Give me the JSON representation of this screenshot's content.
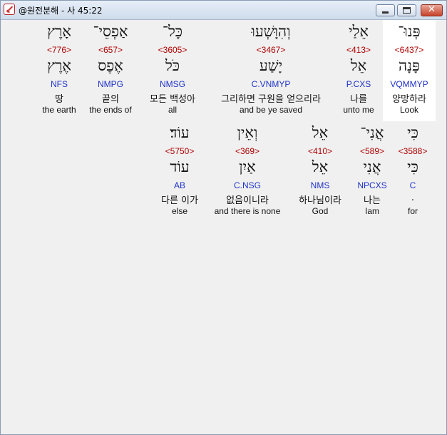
{
  "window": {
    "title": "@원전분해 - 사 45:22"
  },
  "rows": [
    [
      {
        "surface": "פְּנוּ־",
        "strong": "<6437>",
        "lemma": "פָּנָה",
        "morph": "VQMMYP",
        "korean": "양망하라",
        "english": "Look"
      },
      {
        "surface": "אֵלַי",
        "strong": "<413>",
        "lemma": "אֵל",
        "morph": "P.CXS",
        "korean": "나를",
        "english": "unto me"
      },
      {
        "surface": "וְהִוָּשְׁעוּ",
        "strong": "<3467>",
        "lemma": "יָשַׁע",
        "morph": "C.VNMYP",
        "korean": "그리하면 구원을 얻으리라",
        "english": "and be ye saved"
      },
      {
        "surface": "כָּל־",
        "strong": "<3605>",
        "lemma": "כֹּל",
        "morph": "NMSG",
        "korean": "모든 백성아",
        "english": "all"
      },
      {
        "surface": "אַפְסֵי־",
        "strong": "<657>",
        "lemma": "אֶפֶס",
        "morph": "NMPG",
        "korean": "끝의",
        "english": "the ends of"
      },
      {
        "surface": "אָרֶץ",
        "strong": "<776>",
        "lemma": "אֶרֶץ",
        "morph": "NFS",
        "korean": "땅",
        "english": "the earth"
      }
    ],
    [
      {
        "surface": "כִּי",
        "strong": "<3588>",
        "lemma": "כִּי",
        "morph": "C",
        "korean": ".",
        "english": "for"
      },
      {
        "surface": "אֲנִי־",
        "strong": "<589>",
        "lemma": "אֲנִי",
        "morph": "NPCXS",
        "korean": "나는",
        "english": "Iam"
      },
      {
        "surface": "אֵל",
        "strong": "<410>",
        "lemma": "אֵל",
        "morph": "NMS",
        "korean": "하나님이라",
        "english": "God"
      },
      {
        "surface": "וְאֵין",
        "strong": "<369>",
        "lemma": "אַיִן",
        "morph": "C.NSG",
        "korean": "없음이니라",
        "english": "and there is none"
      },
      {
        "surface": "עוֹד׃",
        "strong": "<5750>",
        "lemma": "עוֹד",
        "morph": "AB",
        "korean": "다른 이가",
        "english": "else"
      }
    ]
  ]
}
